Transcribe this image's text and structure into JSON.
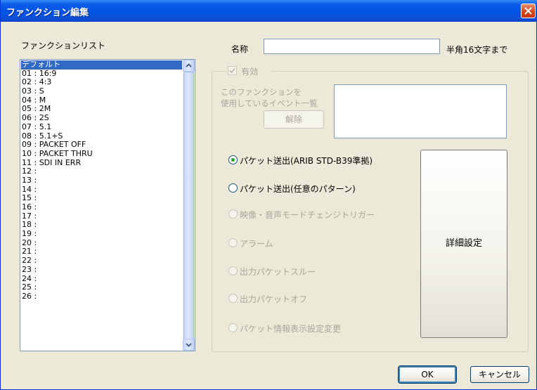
{
  "window": {
    "title": "ファンクション編集"
  },
  "list": {
    "label": "ファンクションリスト",
    "items": [
      "デフォルト",
      "01 : 16:9",
      "02 : 4:3",
      "03 : S",
      "04 : M",
      "05 : 2M",
      "06 : 2S",
      "07 : 5.1",
      "08 : 5.1+S",
      "09 : PACKET OFF",
      "10 : PACKET THRU",
      "11 : SDI IN ERR",
      "12 :",
      "13 :",
      "14 :",
      "15 :",
      "16 :",
      "17 :",
      "18 :",
      "19 :",
      "20 :",
      "21 :",
      "22 :",
      "23 :",
      "24 :",
      "25 :",
      "26 :"
    ],
    "selected_index": 0
  },
  "name": {
    "label": "名称",
    "value": "",
    "hint": "半角16文字まで"
  },
  "enabled": {
    "label": "有効",
    "checked": true
  },
  "events": {
    "label_line1": "このファンクションを",
    "label_line2": "使用しているイベント一覧",
    "remove_button": "解除"
  },
  "modes": [
    {
      "label": "パケット送出(ARIB STD-B39準拠)",
      "selected": true,
      "enabled": true
    },
    {
      "label": "パケット送出(任意のパターン)",
      "selected": false,
      "enabled": true
    },
    {
      "label": "映像・音声モードチェンジトリガー",
      "selected": false,
      "enabled": false
    },
    {
      "label": "アラーム",
      "selected": false,
      "enabled": false
    },
    {
      "label": "出力パケットスルー",
      "selected": false,
      "enabled": false
    },
    {
      "label": "出力パケットオフ",
      "selected": false,
      "enabled": false
    },
    {
      "label": "パケット情報表示設定変更",
      "selected": false,
      "enabled": false
    }
  ],
  "detail_button": "詳細設定",
  "footer": {
    "ok": "OK",
    "cancel": "キャンセル"
  },
  "colors": {
    "titlebar": "#0054e3",
    "selection": "#316ac5",
    "radio_dot": "#21a121",
    "dialog_bg": "#ece9d8"
  }
}
